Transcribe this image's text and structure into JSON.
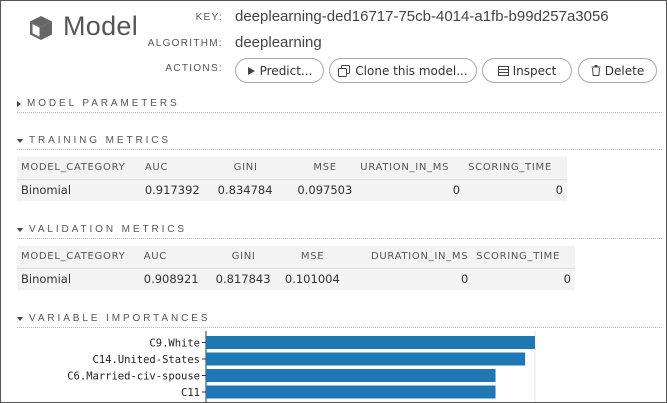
{
  "header": {
    "title": "Model",
    "key_label": "KEY:",
    "key_value": "deeplearning-ded16717-75cb-4014-a1fb-b99d257a3056",
    "algorithm_label": "ALGORITHM:",
    "algorithm_value": "deeplearning",
    "actions_label": "ACTIONS:"
  },
  "actions": {
    "predict": "Predict...",
    "clone": "Clone this model...",
    "inspect": "Inspect",
    "delete": "Delete"
  },
  "sections": {
    "model_parameters": "MODEL PARAMETERS",
    "training_metrics": "TRAINING METRICS",
    "validation_metrics": "VALIDATION METRICS",
    "variable_importances": "VARIABLE IMPORTANCES"
  },
  "training_metrics": {
    "columns": [
      "MODEL_CATEGORY",
      "AUC",
      "GINI",
      "MSE",
      "URATION_IN_MS",
      "SCORING_TIME"
    ],
    "row": [
      "Binomial",
      "0.917392",
      "0.834784",
      "0.097503",
      "0",
      "0"
    ]
  },
  "validation_metrics": {
    "columns": [
      "MODEL_CATEGORY",
      "AUC",
      "GINI",
      "MSE",
      "DURATION_IN_MS",
      "SCORING_TIME"
    ],
    "row": [
      "Binomial",
      "0.908921",
      "0.817843",
      "0.101004",
      "0",
      "0"
    ]
  },
  "chart_data": {
    "type": "bar",
    "orientation": "horizontal",
    "categories": [
      "C9.White",
      "C14.United-States",
      "C6.Married-civ-spouse",
      "C11"
    ],
    "values": [
      1.0,
      0.97,
      0.88,
      0.88
    ],
    "xlim": [
      0,
      1
    ],
    "color": "#1f77b4"
  },
  "icons": {
    "model": "cube-icon",
    "predict": "play-icon",
    "clone": "copy-icon",
    "inspect": "table-icon",
    "delete": "trash-icon"
  }
}
